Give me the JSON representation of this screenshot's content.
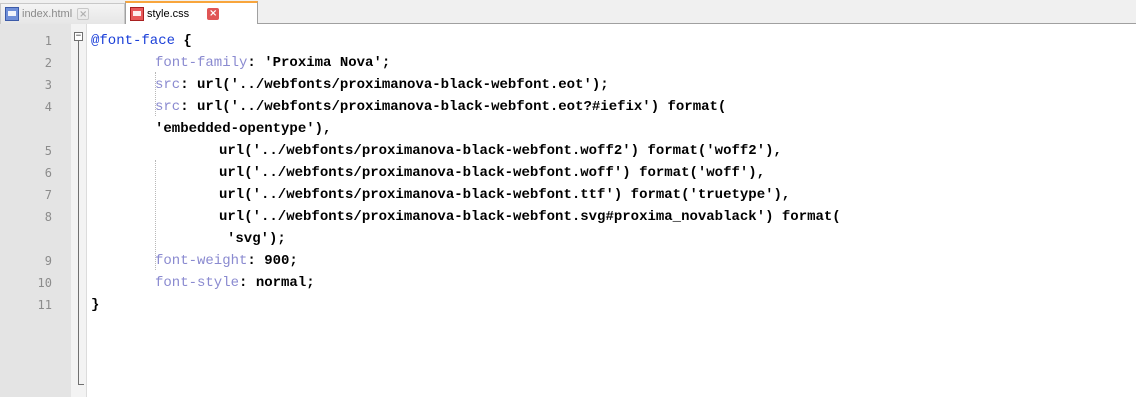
{
  "tabs": [
    {
      "label": "index.html",
      "active": false,
      "icon": "blue-file-icon"
    },
    {
      "label": "style.css",
      "active": true,
      "icon": "red-file-icon"
    }
  ],
  "lines": [
    {
      "num": "1",
      "parts": [
        {
          "t": "@font-face",
          "c": "kw"
        },
        {
          "t": " {",
          "c": ""
        }
      ]
    },
    {
      "num": "2",
      "parts": [
        {
          "t": "font-family",
          "c": "prop"
        },
        {
          "t": ": 'Proxima Nova';",
          "c": ""
        }
      ]
    },
    {
      "num": "3",
      "parts": [
        {
          "t": "src",
          "c": "prop"
        },
        {
          "t": ": url('../webfonts/proximanova-black-webfont.eot');",
          "c": ""
        }
      ]
    },
    {
      "num": "4",
      "parts": [
        {
          "t": "src",
          "c": "prop"
        },
        {
          "t": ": url('../webfonts/proximanova-black-webfont.eot?#iefix') format(",
          "c": ""
        }
      ]
    },
    {
      "num": "",
      "parts": [
        {
          "t": "'embedded-opentype'),",
          "c": ""
        }
      ]
    },
    {
      "num": "5",
      "parts": [
        {
          "t": "url('../webfonts/proximanova-black-webfont.woff2') format('woff2'),",
          "c": ""
        }
      ]
    },
    {
      "num": "6",
      "parts": [
        {
          "t": "url('../webfonts/proximanova-black-webfont.woff') format('woff'),",
          "c": ""
        }
      ]
    },
    {
      "num": "7",
      "parts": [
        {
          "t": "url('../webfonts/proximanova-black-webfont.ttf') format('truetype'),",
          "c": ""
        }
      ]
    },
    {
      "num": "8",
      "parts": [
        {
          "t": "url('../webfonts/proximanova-black-webfont.svg#proxima_novablack') format(",
          "c": ""
        }
      ]
    },
    {
      "num": "",
      "parts": [
        {
          "t": "'svg');",
          "c": ""
        }
      ]
    },
    {
      "num": "9",
      "parts": [
        {
          "t": "font-weight",
          "c": "prop"
        },
        {
          "t": ": 900;",
          "c": ""
        }
      ]
    },
    {
      "num": "10",
      "parts": [
        {
          "t": "font-style",
          "c": "prop"
        },
        {
          "t": ": normal;",
          "c": ""
        }
      ]
    },
    {
      "num": "11",
      "parts": [
        {
          "t": "}",
          "c": ""
        }
      ]
    }
  ],
  "colors": {
    "keyword": "#1a3fd8",
    "property": "#8a8ad0",
    "active_tab_accent": "#f8a53c"
  }
}
